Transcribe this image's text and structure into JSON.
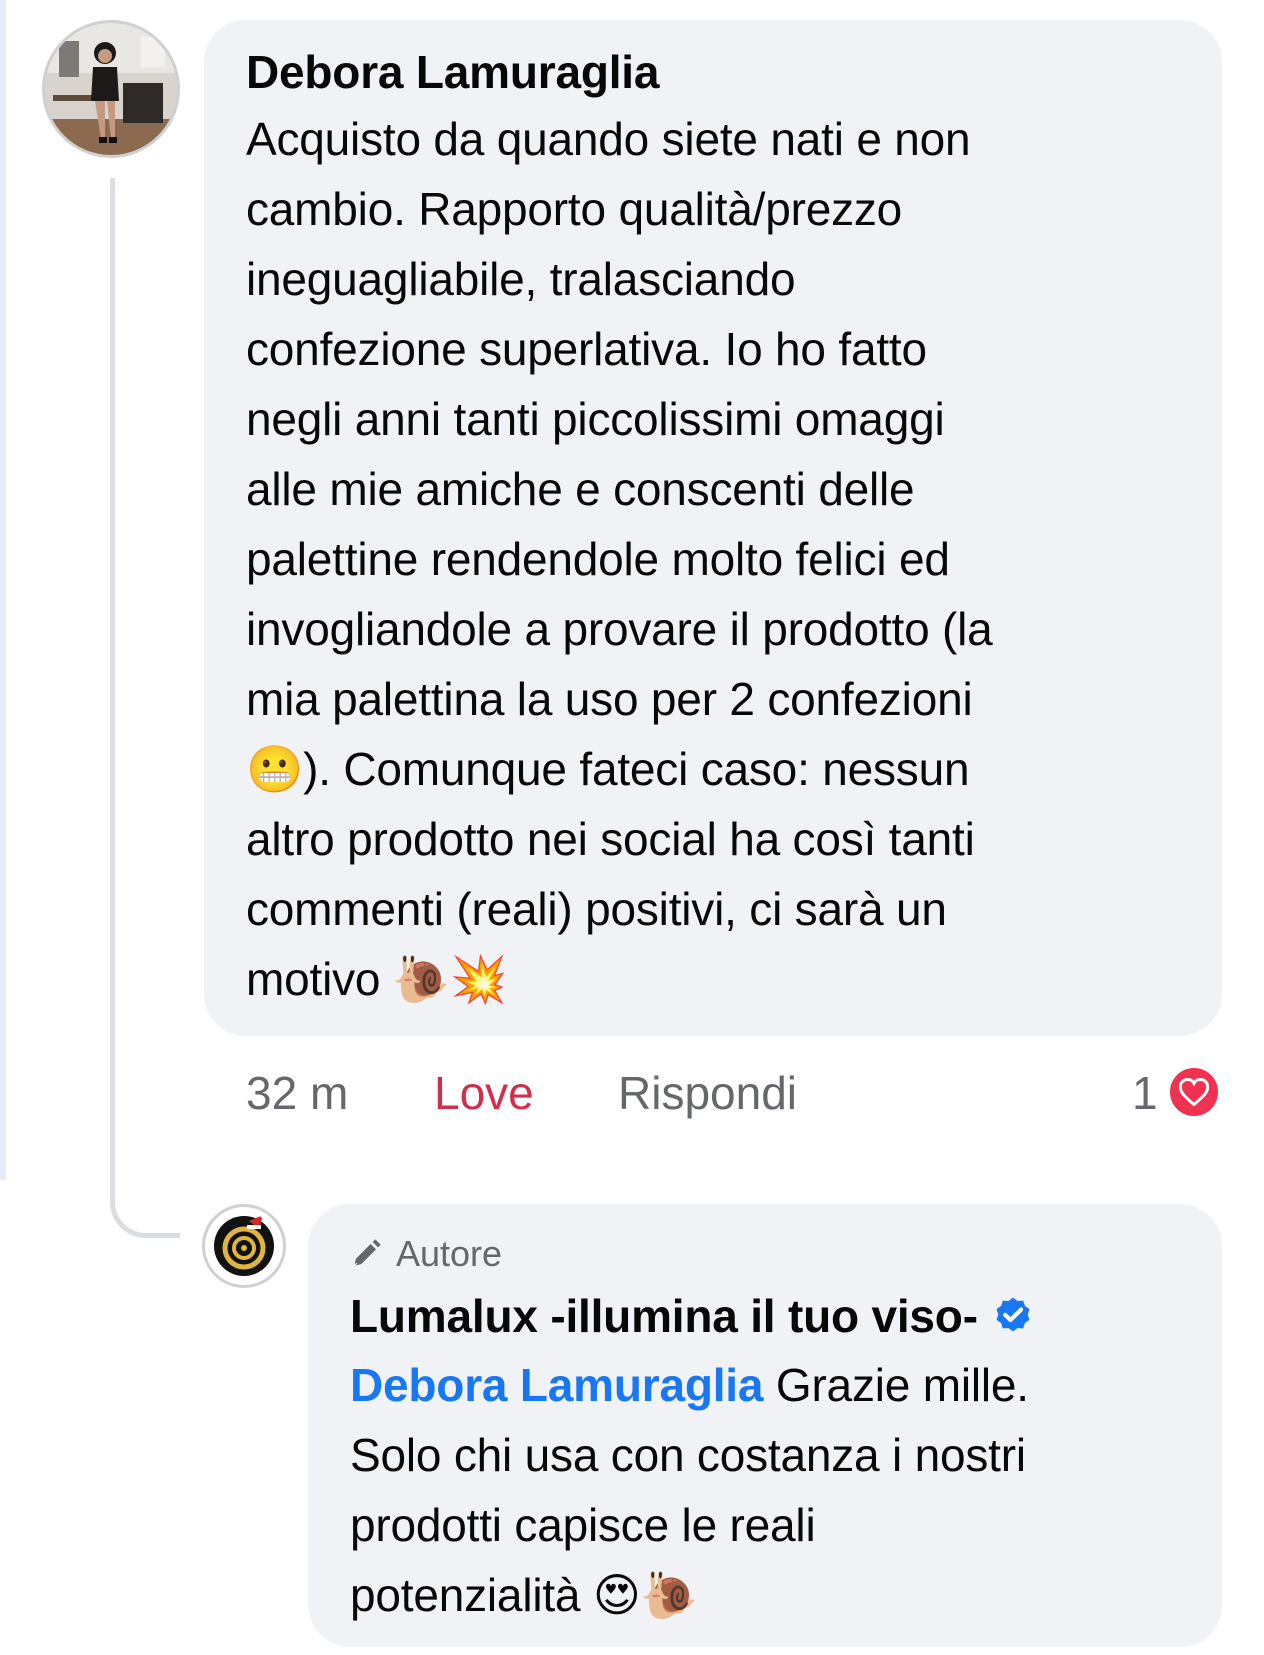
{
  "comment": {
    "author": "Debora Lamuraglia",
    "text_lines": [
      "Acquisto da quando siete nati e non",
      "cambio. Rapporto qualità/prezzo",
      "ineguagliabile, tralasciando",
      "confezione superlativa. Io ho fatto",
      "negli anni tanti piccolissimi omaggi",
      "alle mie amiche e conscenti delle",
      "palettine rendendole molto felici ed",
      "invogliandole a provare il prodotto (la",
      "mia palettina la uso per 2 confezioni"
    ],
    "line10_emoji": "😬",
    "line10_text": "). Comunque fateci caso: nessun",
    "line11": "altro prodotto nei social ha così tanti",
    "line12": "commenti (reali) positivi, ci sarà un",
    "line13_text": "motivo ",
    "line13_emoji": "🐌💥",
    "time": "32 m",
    "reaction_label": "Love",
    "reply_label": "Rispondi",
    "reaction_count": "1",
    "heart_color": "#f0314f"
  },
  "reply": {
    "badge_label": "Autore",
    "badge_icon": "pencil-icon",
    "author": "Lumalux -illumina il tuo viso-",
    "verified_icon": "verified-badge-icon",
    "mention": "Debora Lamuraglia",
    "text_after_mention": " Grazie mille.",
    "line2": "Solo chi usa con costanza i nostri",
    "line3": "prodotti capisce le reali",
    "line4_text": "potenzialità ",
    "line4_emoji": "😍🐌",
    "mention_color": "#1877f2"
  }
}
